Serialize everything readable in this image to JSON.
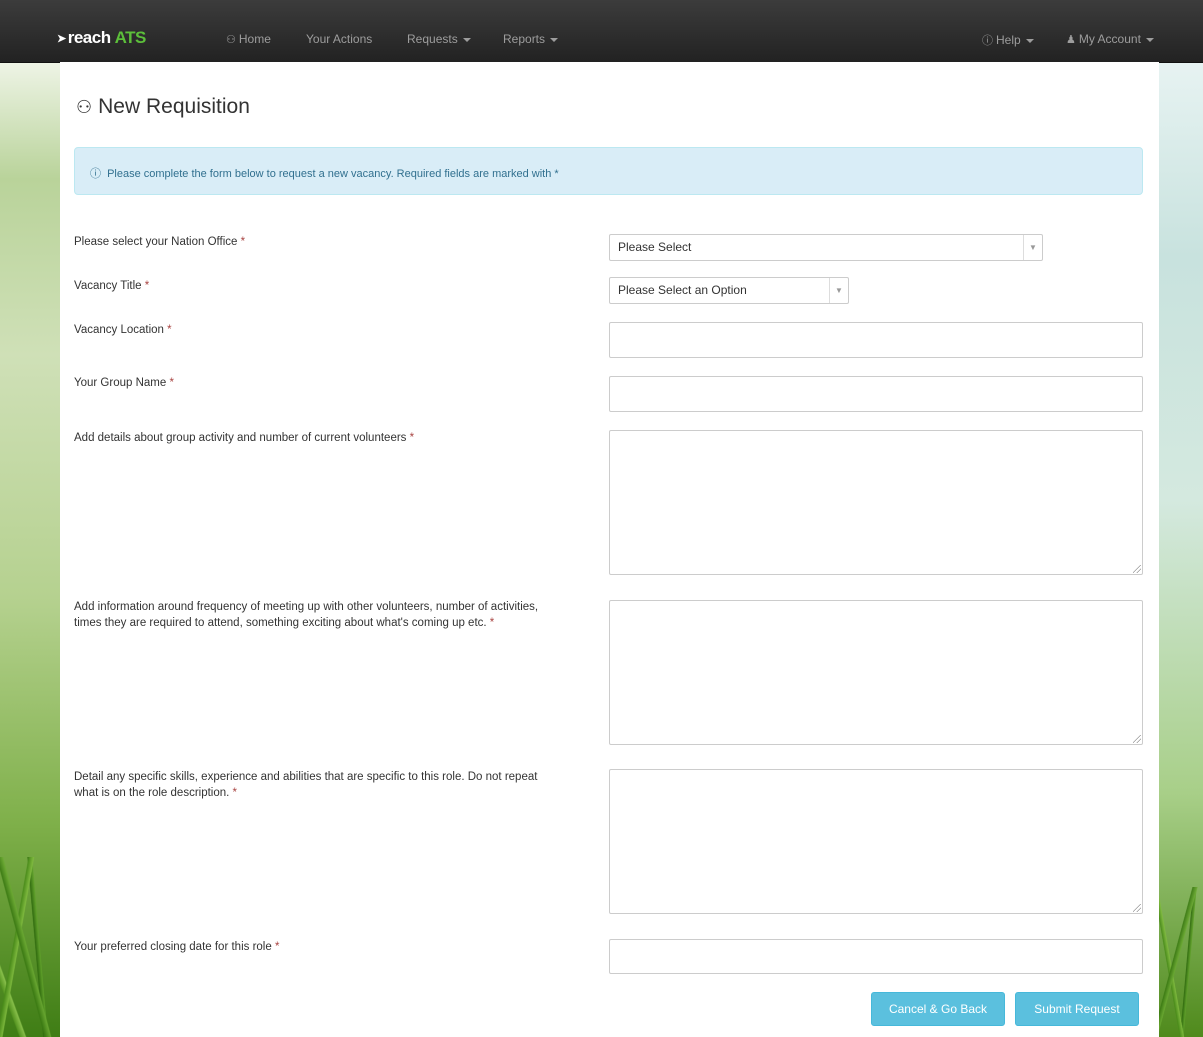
{
  "nav": {
    "brand_prefix": "reach",
    "brand_suffix": "ATS",
    "home": "Home",
    "your_actions": "Your Actions",
    "requests": "Requests",
    "reports": "Reports",
    "help": "Help",
    "my_account": "My Account"
  },
  "page": {
    "title": "New Requisition",
    "alert": "Please complete the form below to request a new vacancy. Required fields are marked with *"
  },
  "form": {
    "required_marker": "*",
    "nation_office_label": "Please select your Nation Office",
    "nation_office_value": "Please Select",
    "vacancy_title_label": "Vacancy Title",
    "vacancy_title_value": "Please Select an Option",
    "vacancy_location_label": "Vacancy Location",
    "group_name_label": "Your Group Name",
    "group_activity_label": "Add details about group activity and number of current volunteers",
    "frequency_label": "Add information around frequency of meeting up with other volunteers, number of activities, times they are required to attend, something exciting about what's coming up etc.",
    "skills_label": "Detail any specific skills, experience and abilities that are specific to this role. Do not repeat what is on the role description.",
    "closing_date_label": "Your preferred closing date for this role"
  },
  "buttons": {
    "cancel": "Cancel & Go Back",
    "submit": "Submit Request"
  },
  "colors": {
    "navbar": "#222222",
    "brand_accent": "#5cbf3a",
    "alert_bg": "#d9edf7",
    "button": "#5bc0de",
    "required": "#a94442"
  }
}
